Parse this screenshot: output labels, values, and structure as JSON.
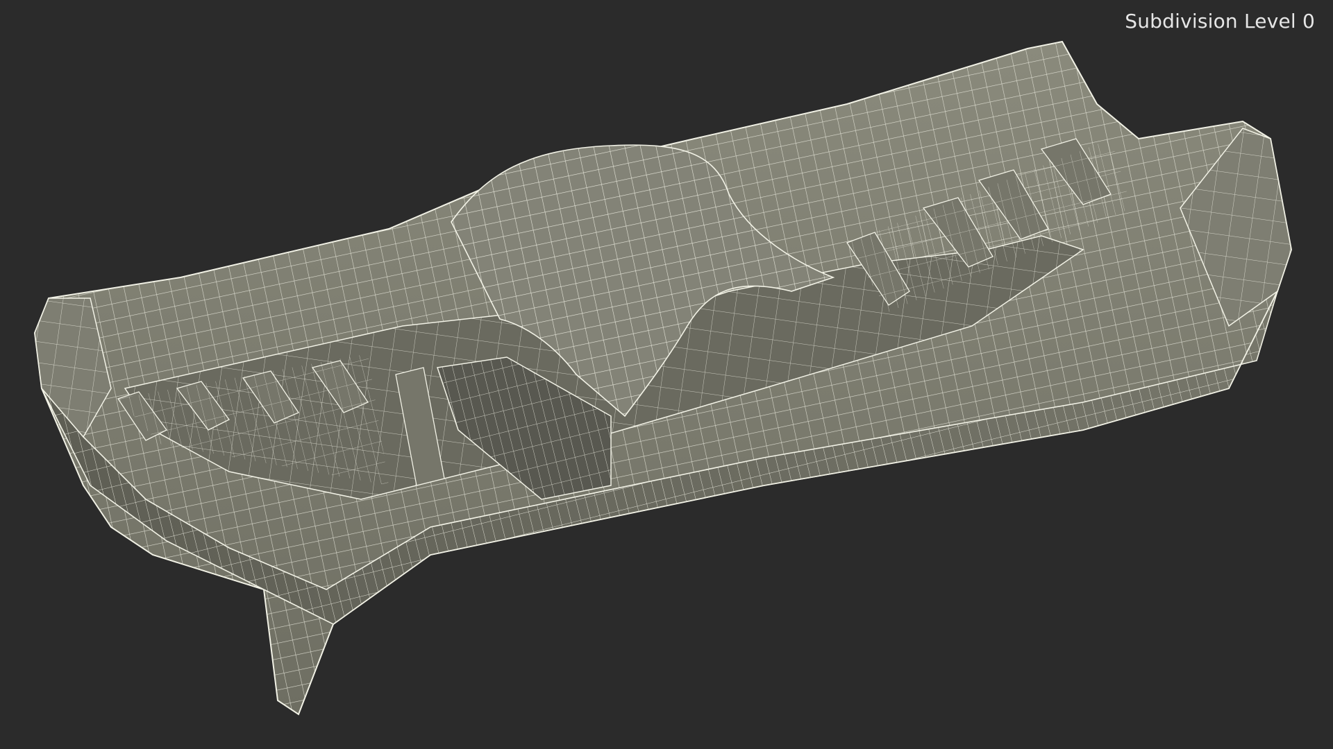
{
  "viewport": {
    "overlay_label": "Subdivision Level 0",
    "background_color": "#2b2b2b",
    "model_color": "#7a7a6e",
    "wire_color": "#f2f2e6"
  }
}
